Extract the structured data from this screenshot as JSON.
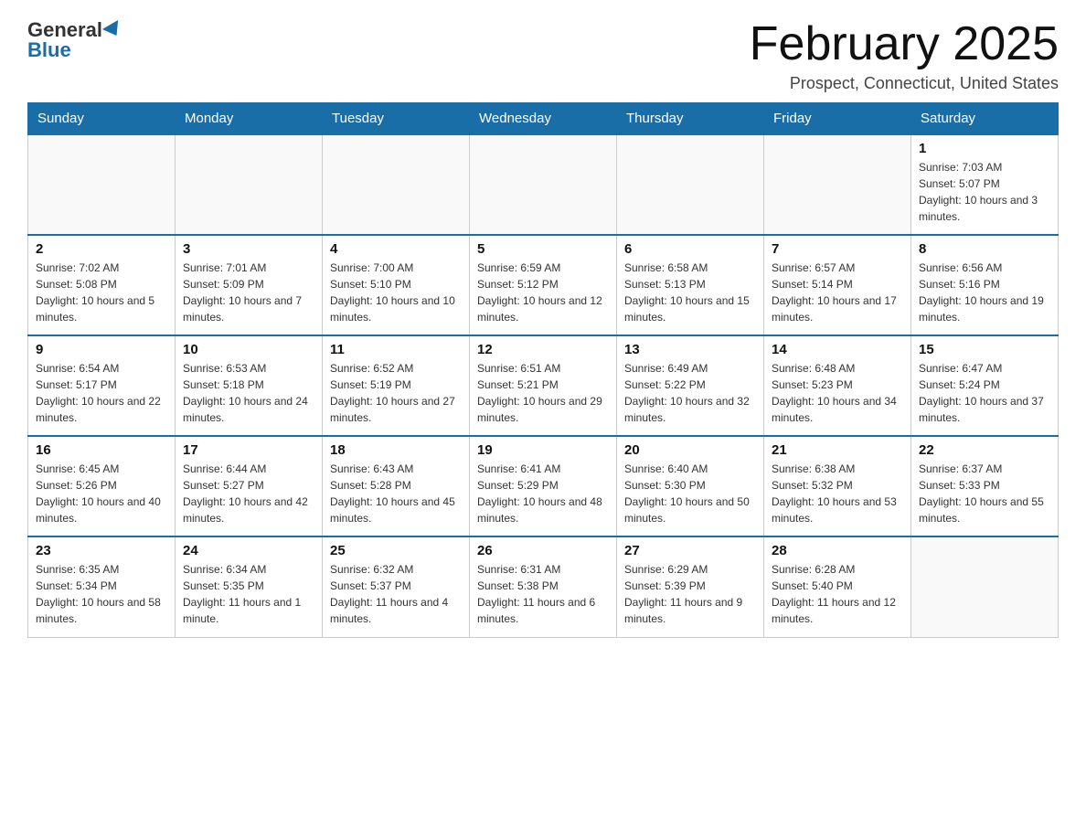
{
  "header": {
    "logo_general": "General",
    "logo_blue": "Blue",
    "month_title": "February 2025",
    "location": "Prospect, Connecticut, United States"
  },
  "weekdays": [
    "Sunday",
    "Monday",
    "Tuesday",
    "Wednesday",
    "Thursday",
    "Friday",
    "Saturday"
  ],
  "weeks": [
    [
      {
        "day": "",
        "info": ""
      },
      {
        "day": "",
        "info": ""
      },
      {
        "day": "",
        "info": ""
      },
      {
        "day": "",
        "info": ""
      },
      {
        "day": "",
        "info": ""
      },
      {
        "day": "",
        "info": ""
      },
      {
        "day": "1",
        "info": "Sunrise: 7:03 AM\nSunset: 5:07 PM\nDaylight: 10 hours and 3 minutes."
      }
    ],
    [
      {
        "day": "2",
        "info": "Sunrise: 7:02 AM\nSunset: 5:08 PM\nDaylight: 10 hours and 5 minutes."
      },
      {
        "day": "3",
        "info": "Sunrise: 7:01 AM\nSunset: 5:09 PM\nDaylight: 10 hours and 7 minutes."
      },
      {
        "day": "4",
        "info": "Sunrise: 7:00 AM\nSunset: 5:10 PM\nDaylight: 10 hours and 10 minutes."
      },
      {
        "day": "5",
        "info": "Sunrise: 6:59 AM\nSunset: 5:12 PM\nDaylight: 10 hours and 12 minutes."
      },
      {
        "day": "6",
        "info": "Sunrise: 6:58 AM\nSunset: 5:13 PM\nDaylight: 10 hours and 15 minutes."
      },
      {
        "day": "7",
        "info": "Sunrise: 6:57 AM\nSunset: 5:14 PM\nDaylight: 10 hours and 17 minutes."
      },
      {
        "day": "8",
        "info": "Sunrise: 6:56 AM\nSunset: 5:16 PM\nDaylight: 10 hours and 19 minutes."
      }
    ],
    [
      {
        "day": "9",
        "info": "Sunrise: 6:54 AM\nSunset: 5:17 PM\nDaylight: 10 hours and 22 minutes."
      },
      {
        "day": "10",
        "info": "Sunrise: 6:53 AM\nSunset: 5:18 PM\nDaylight: 10 hours and 24 minutes."
      },
      {
        "day": "11",
        "info": "Sunrise: 6:52 AM\nSunset: 5:19 PM\nDaylight: 10 hours and 27 minutes."
      },
      {
        "day": "12",
        "info": "Sunrise: 6:51 AM\nSunset: 5:21 PM\nDaylight: 10 hours and 29 minutes."
      },
      {
        "day": "13",
        "info": "Sunrise: 6:49 AM\nSunset: 5:22 PM\nDaylight: 10 hours and 32 minutes."
      },
      {
        "day": "14",
        "info": "Sunrise: 6:48 AM\nSunset: 5:23 PM\nDaylight: 10 hours and 34 minutes."
      },
      {
        "day": "15",
        "info": "Sunrise: 6:47 AM\nSunset: 5:24 PM\nDaylight: 10 hours and 37 minutes."
      }
    ],
    [
      {
        "day": "16",
        "info": "Sunrise: 6:45 AM\nSunset: 5:26 PM\nDaylight: 10 hours and 40 minutes."
      },
      {
        "day": "17",
        "info": "Sunrise: 6:44 AM\nSunset: 5:27 PM\nDaylight: 10 hours and 42 minutes."
      },
      {
        "day": "18",
        "info": "Sunrise: 6:43 AM\nSunset: 5:28 PM\nDaylight: 10 hours and 45 minutes."
      },
      {
        "day": "19",
        "info": "Sunrise: 6:41 AM\nSunset: 5:29 PM\nDaylight: 10 hours and 48 minutes."
      },
      {
        "day": "20",
        "info": "Sunrise: 6:40 AM\nSunset: 5:30 PM\nDaylight: 10 hours and 50 minutes."
      },
      {
        "day": "21",
        "info": "Sunrise: 6:38 AM\nSunset: 5:32 PM\nDaylight: 10 hours and 53 minutes."
      },
      {
        "day": "22",
        "info": "Sunrise: 6:37 AM\nSunset: 5:33 PM\nDaylight: 10 hours and 55 minutes."
      }
    ],
    [
      {
        "day": "23",
        "info": "Sunrise: 6:35 AM\nSunset: 5:34 PM\nDaylight: 10 hours and 58 minutes."
      },
      {
        "day": "24",
        "info": "Sunrise: 6:34 AM\nSunset: 5:35 PM\nDaylight: 11 hours and 1 minute."
      },
      {
        "day": "25",
        "info": "Sunrise: 6:32 AM\nSunset: 5:37 PM\nDaylight: 11 hours and 4 minutes."
      },
      {
        "day": "26",
        "info": "Sunrise: 6:31 AM\nSunset: 5:38 PM\nDaylight: 11 hours and 6 minutes."
      },
      {
        "day": "27",
        "info": "Sunrise: 6:29 AM\nSunset: 5:39 PM\nDaylight: 11 hours and 9 minutes."
      },
      {
        "day": "28",
        "info": "Sunrise: 6:28 AM\nSunset: 5:40 PM\nDaylight: 11 hours and 12 minutes."
      },
      {
        "day": "",
        "info": ""
      }
    ]
  ]
}
